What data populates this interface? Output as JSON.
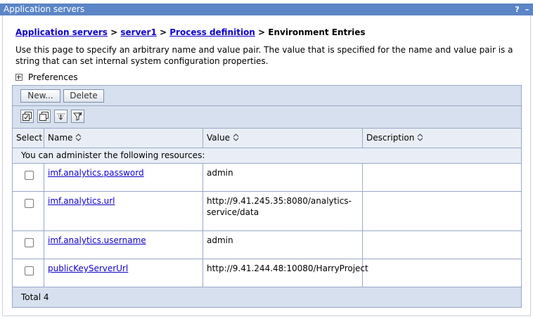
{
  "window": {
    "title": "Application servers",
    "help_label": "?",
    "minimize_label": "–"
  },
  "breadcrumb": {
    "items": [
      "Application servers",
      "server1",
      "Process definition"
    ],
    "separator": ">",
    "current": "Environment Entries"
  },
  "description": "Use this page to specify an arbitrary name and value pair. The value that is specified for the name and value pair is a string that can set internal system configuration properties.",
  "preferences_label": "Preferences",
  "toolbar": {
    "new_label": "New...",
    "delete_label": "Delete"
  },
  "icon_toolbar": [
    "select-all-icon",
    "deselect-all-icon",
    "show-filter-icon",
    "clear-filter-icon"
  ],
  "table": {
    "columns": [
      "Select",
      "Name",
      "Value",
      "Description"
    ],
    "admin_note": "You can administer the following resources:",
    "rows": [
      {
        "name": "imf.analytics.password",
        "value": "admin",
        "description": ""
      },
      {
        "name": "imf.analytics.url",
        "value": "http://9.41.245.35:8080/analytics-service/data",
        "value_line1": "http://9.41.245.35:8080/analytics-",
        "value_line2": "service/data",
        "description": ""
      },
      {
        "name": "imf.analytics.username",
        "value": "admin",
        "description": ""
      },
      {
        "name": "publicKeyServerUrl",
        "value": "http://9.41.244.48:10080/HarryProject",
        "description": ""
      }
    ],
    "total": "Total 4"
  },
  "colors": {
    "title_bar": "#5b85c6",
    "link": "#1000c9",
    "toolbar_bg": "#d7e0ee",
    "header_bg": "#e9eef6",
    "border": "#98a9c9"
  }
}
